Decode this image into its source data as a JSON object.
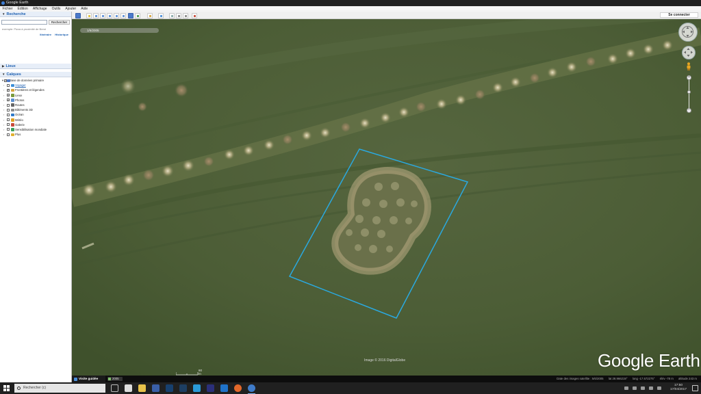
{
  "window": {
    "title": "Google Earth",
    "signin_label": "Se connecter"
  },
  "menu": [
    "Fichier",
    "Édition",
    "Affichage",
    "Outils",
    "Ajouter",
    "Aide"
  ],
  "search_panel": {
    "title": "Recherche",
    "input_value": "",
    "button_label": "Rechercher",
    "hint": "exemple: Pizza à proximité de Brest",
    "link_directions": "Itinéraire",
    "link_history": "Historique"
  },
  "places_panel": {
    "title": "Lieux"
  },
  "layers_panel": {
    "title": "Calques",
    "items": [
      {
        "label": "Base de données primaire",
        "checked": true,
        "top": true,
        "icon_color": "#4b79c9"
      },
      {
        "label": "Voyager",
        "checked": false,
        "link": true,
        "icon_color": "#3d8fd8"
      },
      {
        "label": "Frontières et légendes",
        "checked": true,
        "icon_color": "#d8a43d"
      },
      {
        "label": "Lieux",
        "checked": true,
        "icon_color": "#7a9a3d"
      },
      {
        "label": "Photos",
        "checked": true,
        "icon_color": "#5a8fd0"
      },
      {
        "label": "Routes",
        "checked": false,
        "icon_color": "#666666"
      },
      {
        "label": "Bâtiments 3D",
        "checked": false,
        "icon_color": "#8a8a8a"
      },
      {
        "label": "Océan",
        "checked": false,
        "icon_color": "#2f7ac8"
      },
      {
        "label": "Météo",
        "checked": false,
        "icon_color": "#e0a020"
      },
      {
        "label": "Galerie",
        "checked": false,
        "icon_color": "#c84a3a"
      },
      {
        "label": "Sensibilisation mondiale",
        "checked": false,
        "icon_color": "#3aa05a"
      },
      {
        "label": "Plus",
        "checked": false,
        "icon_color": "#e0b030"
      }
    ]
  },
  "map": {
    "top_scale_label": "1/6/2005",
    "imagery_credit": "Image © 2016 DigitalGlobe",
    "brand": "Google Earth",
    "scale_label": "60 m"
  },
  "statusbar": {
    "tour_label": "Visite guidée",
    "history_label": "2005",
    "imagery_date": "Date des images satellite : 5/6/2005",
    "lat": "lat  28.966219°",
    "lon": "long  -17.572275°",
    "elev": "élév  -78 m",
    "altitude": "altitude  243 m"
  },
  "taskbar": {
    "search_placeholder": "Rechercher (c)",
    "time": "17:50",
    "date": "17/04/2017"
  },
  "colors": {
    "selection_outline": "#2aa9e0",
    "accent": "#1c5fb0"
  }
}
